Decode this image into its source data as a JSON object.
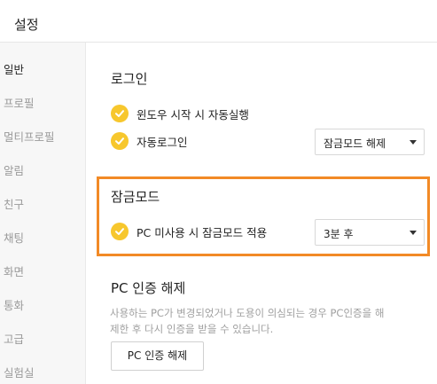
{
  "window": {
    "title": "설정"
  },
  "sidebar": {
    "items": [
      {
        "label": "일반",
        "active": true
      },
      {
        "label": "프로필",
        "active": false
      },
      {
        "label": "멀티프로필",
        "active": false
      },
      {
        "label": "알림",
        "active": false
      },
      {
        "label": "친구",
        "active": false
      },
      {
        "label": "채팅",
        "active": false
      },
      {
        "label": "화면",
        "active": false
      },
      {
        "label": "통화",
        "active": false
      },
      {
        "label": "고급",
        "active": false
      },
      {
        "label": "실험실",
        "active": false
      }
    ]
  },
  "login": {
    "title": "로그인",
    "autostart_label": "윈도우 시작 시 자동실행",
    "autostart_checked": true,
    "autologin_label": "자동로그인",
    "autologin_checked": true,
    "autologin_select": "잠금모드 해제"
  },
  "lock": {
    "title": "잠금모드",
    "idle_label": "PC 미사용 시 잠금모드 적용",
    "idle_checked": true,
    "idle_select": "3분 후"
  },
  "pc_auth": {
    "title": "PC 인증 해제",
    "description_line1": "사용하는 PC가 변경되었거나 도용이 의심되는 경우 PC인증을 해",
    "description_line2": "제한 후 다시 인증을 받을 수 있습니다.",
    "button_label": "PC 인증 해제"
  },
  "colors": {
    "check": "#f7c72d",
    "highlight": "#f28a26"
  }
}
